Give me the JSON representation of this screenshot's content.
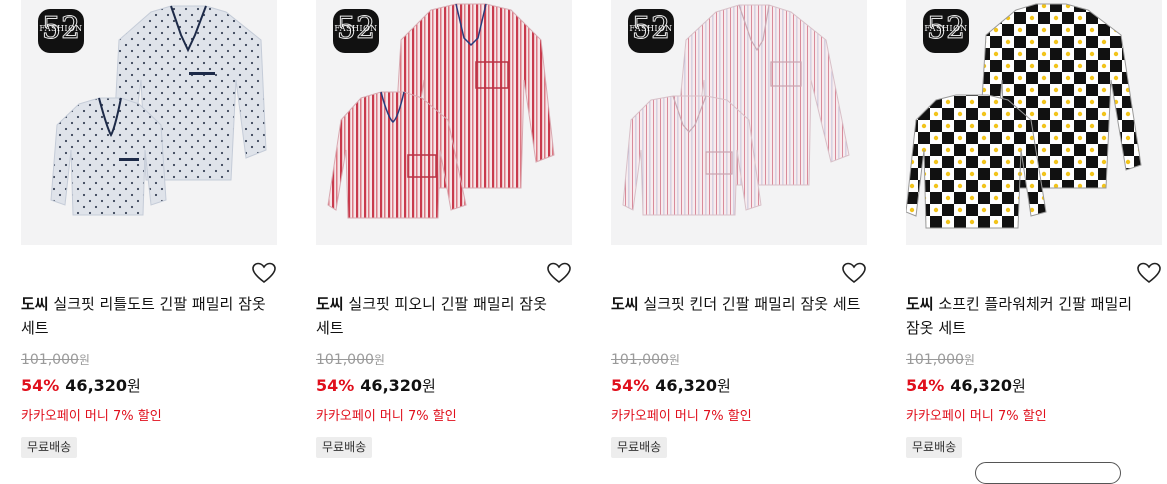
{
  "brand_logo": {
    "number": "52",
    "text": "FASHION",
    "color": "#111111"
  },
  "accent_color": "#e00f1c",
  "products": [
    {
      "brand": "도씨",
      "name": "실크핏 리틀도트 긴팔 패밀리 잠옷 세트",
      "original_price": "101,000",
      "original_unit": "원",
      "discount": "54%",
      "price": "46,320",
      "price_unit": "원",
      "promo": "카카오페이 머니 7% 할인",
      "badge": "무료배송",
      "pattern": "dots",
      "fabric_color": "#dfe3ea"
    },
    {
      "brand": "도씨",
      "name": "실크핏 피오니 긴팔 패밀리 잠옷 세트",
      "original_price": "101,000",
      "original_unit": "원",
      "discount": "54%",
      "price": "46,320",
      "price_unit": "원",
      "promo": "카카오페이 머니 7% 할인",
      "badge": "무료배송",
      "pattern": "red-stripes",
      "fabric_color": "#f2dde0"
    },
    {
      "brand": "도씨",
      "name": "실크핏 킨더 긴팔 패밀리 잠옷 세트",
      "original_price": "101,000",
      "original_unit": "원",
      "discount": "54%",
      "price": "46,320",
      "price_unit": "원",
      "promo": "카카오페이 머니 7% 할인",
      "badge": "무료배송",
      "pattern": "pink-stripes",
      "fabric_color": "#f4e6ea"
    },
    {
      "brand": "도씨",
      "name": "소프킨 플라워체커 긴팔 패밀리 잠옷 세트",
      "original_price": "101,000",
      "original_unit": "원",
      "discount": "54%",
      "price": "46,320",
      "price_unit": "원",
      "promo": "카카오페이 머니 7% 할인",
      "badge": "무료배송",
      "pattern": "checker",
      "fabric_color": "#ffffff"
    }
  ]
}
